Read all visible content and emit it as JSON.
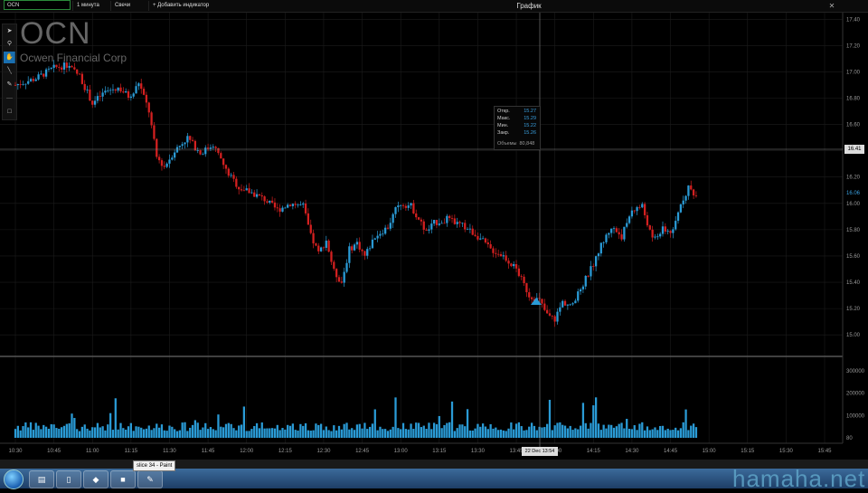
{
  "topbar": {
    "symbol": "OCN",
    "interval": "1 минута",
    "chart_type": "Свечи",
    "add_indicator": "+ Добавить индикатор",
    "title": "График",
    "close": "✕"
  },
  "tools": [
    "cursor-icon",
    "zoom-icon",
    "hand-icon",
    "line-icon",
    "pen-icon",
    "horizontal-line-icon",
    "rectangle-icon"
  ],
  "header": {
    "ticker": "OCN",
    "company": "Ocwen Financial Corp"
  },
  "tooltip": {
    "rows": [
      {
        "label": "Откр.",
        "value": "15.27"
      },
      {
        "label": "Макс.",
        "value": "15.29"
      },
      {
        "label": "Мин.",
        "value": "15.22"
      },
      {
        "label": "Закр.",
        "value": "15.26"
      }
    ],
    "volume_label": "Объемы",
    "volume_value": "80,848"
  },
  "crosshair": {
    "price": "16.41",
    "datetime": "22 Dec 13:54"
  },
  "last_price": "16.06",
  "colors": {
    "up": "#2a9bd6",
    "down": "#d42020",
    "grid": "#1c1c1c",
    "accent": "#1a6fb0"
  },
  "chart_data": {
    "type": "candlestick",
    "x_ticks": [
      "10:30",
      "10:45",
      "11:00",
      "11:15",
      "11:30",
      "11:45",
      "12:00",
      "12:15",
      "12:30",
      "12:45",
      "13:00",
      "13:15",
      "13:30",
      "13:45",
      "14:00",
      "14:15",
      "14:30",
      "14:45",
      "15:00",
      "15:15",
      "15:30",
      "15:45"
    ],
    "y_ticks": [
      "17.40",
      "17.20",
      "17.00",
      "16.80",
      "16.60",
      "16.40",
      "16.20",
      "16.00",
      "15.80",
      "15.60",
      "15.40",
      "15.20",
      "15.00"
    ],
    "ylim": [
      14.85,
      17.45
    ],
    "volume_ticks": [
      "300000",
      "200000",
      "100000",
      "80"
    ],
    "volume_ylim": [
      0,
      340000
    ],
    "close_path": [
      {
        "x": "10:30",
        "y": 16.9
      },
      {
        "x": "10:38",
        "y": 16.95
      },
      {
        "x": "10:45",
        "y": 17.03
      },
      {
        "x": "10:50",
        "y": 17.05
      },
      {
        "x": "10:55",
        "y": 16.97
      },
      {
        "x": "11:00",
        "y": 16.76
      },
      {
        "x": "11:05",
        "y": 16.85
      },
      {
        "x": "11:10",
        "y": 16.88
      },
      {
        "x": "11:15",
        "y": 16.8
      },
      {
        "x": "11:18",
        "y": 16.92
      },
      {
        "x": "11:22",
        "y": 16.7
      },
      {
        "x": "11:25",
        "y": 16.35
      },
      {
        "x": "11:28",
        "y": 16.28
      },
      {
        "x": "11:32",
        "y": 16.4
      },
      {
        "x": "11:37",
        "y": 16.5
      },
      {
        "x": "11:42",
        "y": 16.38
      },
      {
        "x": "11:47",
        "y": 16.45
      },
      {
        "x": "11:52",
        "y": 16.25
      },
      {
        "x": "11:57",
        "y": 16.12
      },
      {
        "x": "12:02",
        "y": 16.08
      },
      {
        "x": "12:07",
        "y": 16.03
      },
      {
        "x": "12:12",
        "y": 15.95
      },
      {
        "x": "12:17",
        "y": 16.0
      },
      {
        "x": "12:22",
        "y": 15.98
      },
      {
        "x": "12:25",
        "y": 15.75
      },
      {
        "x": "12:28",
        "y": 15.62
      },
      {
        "x": "12:31",
        "y": 15.72
      },
      {
        "x": "12:34",
        "y": 15.48
      },
      {
        "x": "12:37",
        "y": 15.4
      },
      {
        "x": "12:40",
        "y": 15.65
      },
      {
        "x": "12:43",
        "y": 15.7
      },
      {
        "x": "12:46",
        "y": 15.6
      },
      {
        "x": "12:50",
        "y": 15.75
      },
      {
        "x": "12:55",
        "y": 15.82
      },
      {
        "x": "12:58",
        "y": 15.95
      },
      {
        "x": "13:00",
        "y": 16.0
      },
      {
        "x": "13:04",
        "y": 15.98
      },
      {
        "x": "13:07",
        "y": 15.88
      },
      {
        "x": "13:10",
        "y": 15.78
      },
      {
        "x": "13:13",
        "y": 15.85
      },
      {
        "x": "13:18",
        "y": 15.88
      },
      {
        "x": "13:25",
        "y": 15.82
      },
      {
        "x": "13:30",
        "y": 15.75
      },
      {
        "x": "13:35",
        "y": 15.65
      },
      {
        "x": "13:40",
        "y": 15.6
      },
      {
        "x": "13:45",
        "y": 15.5
      },
      {
        "x": "13:50",
        "y": 15.3
      },
      {
        "x": "13:54",
        "y": 15.26
      },
      {
        "x": "13:57",
        "y": 15.15
      },
      {
        "x": "14:00",
        "y": 15.12
      },
      {
        "x": "14:03",
        "y": 15.25
      },
      {
        "x": "14:07",
        "y": 15.22
      },
      {
        "x": "14:10",
        "y": 15.35
      },
      {
        "x": "14:14",
        "y": 15.5
      },
      {
        "x": "14:18",
        "y": 15.68
      },
      {
        "x": "14:22",
        "y": 15.82
      },
      {
        "x": "14:26",
        "y": 15.75
      },
      {
        "x": "14:30",
        "y": 15.95
      },
      {
        "x": "14:34",
        "y": 15.98
      },
      {
        "x": "14:38",
        "y": 15.72
      },
      {
        "x": "14:42",
        "y": 15.8
      },
      {
        "x": "14:46",
        "y": 15.78
      },
      {
        "x": "14:49",
        "y": 16.0
      },
      {
        "x": "14:52",
        "y": 16.12
      },
      {
        "x": "14:55",
        "y": 16.06
      }
    ]
  },
  "taskbar": {
    "paint_tooltip": "slice 34 - Paint"
  },
  "watermark": "hamaha.net"
}
